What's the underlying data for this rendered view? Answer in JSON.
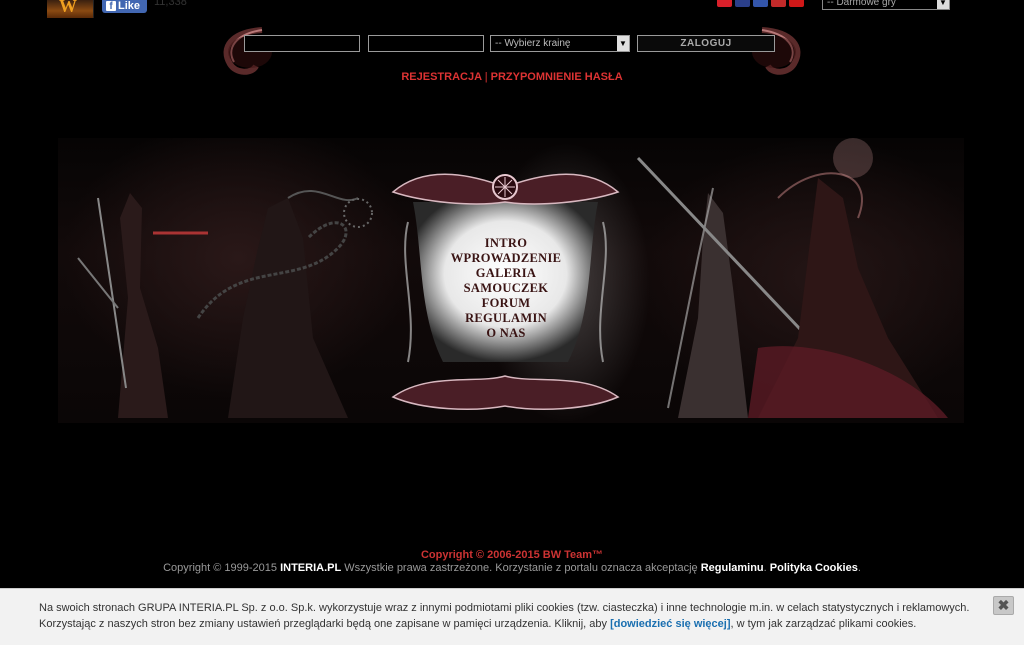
{
  "top": {
    "logo_letter": "W",
    "fb_like_label": "Like",
    "fb_like_icon": "f",
    "fb_count": "11,338",
    "flags": [
      {
        "name": "flag-pl",
        "color": "#d8202a"
      },
      {
        "name": "flag-gb",
        "color": "#2b3f8a"
      },
      {
        "name": "flag-fr",
        "color": "#3355aa"
      },
      {
        "name": "flag-ru",
        "color": "#c22a2a"
      },
      {
        "name": "flag-tr",
        "color": "#d01818"
      }
    ],
    "games_select": "-- Darmowe gry"
  },
  "login": {
    "username": "",
    "password": "",
    "realm_select": "-- Wybierz krainę",
    "login_label": "ZALOGUJ"
  },
  "links": {
    "register": "REJESTRACJA",
    "separator": "|",
    "remind_password": "PRZYPOMNIENIE HASŁA"
  },
  "menu": {
    "items": [
      "INTRO",
      "WPROWADZENIE",
      "GALERIA",
      "SAMOUCZEK",
      "FORUM",
      "REGULAMIN",
      "O NAS"
    ]
  },
  "footer": {
    "copyright_bw": "Copyright © 2006-2015 BW Team™",
    "copyright_prefix": "Copyright © 1999-2015 ",
    "interia": "INTERIA.PL",
    "rights": " Wszystkie prawa zastrzeżone. Korzystanie z portalu oznacza akceptację ",
    "regulamin": "Regulaminu",
    "dot1": ". ",
    "cookies_policy": "Polityka Cookies",
    "dot2": "."
  },
  "cookie_bar": {
    "line1": "Na swoich stronach GRUPA INTERIA.PL Sp. z o.o. Sp.k. wykorzystuje wraz z innymi podmiotami pliki cookies (tzw. ciasteczka) i inne technologie m.in. w celach statystycznych i reklamowych.",
    "line2_prefix": "Korzystając z naszych stron bez zmiany ustawień przeglądarki będą one zapisane w pamięci urządzenia. Kliknij, aby ",
    "link": "[dowiedzieć się więcej]",
    "line2_suffix": ", w tym jak zarządzać plikami cookies.",
    "close": "✖"
  },
  "colors": {
    "accent_red": "#d33",
    "background": "#000"
  }
}
